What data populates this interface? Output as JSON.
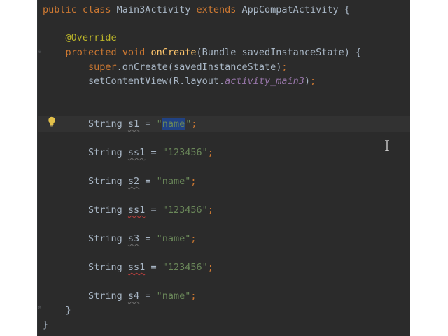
{
  "lines": [
    {
      "parts": [
        {
          "t": "public class ",
          "c": "kw"
        },
        {
          "t": "Main3Activity ",
          "c": ""
        },
        {
          "t": "extends ",
          "c": "kw"
        },
        {
          "t": "AppCompatActivity {",
          "c": ""
        }
      ]
    },
    {
      "parts": [
        {
          "t": "    @Override",
          "c": "ann"
        }
      ]
    },
    {
      "parts": [
        {
          "t": "    protected void ",
          "c": "kw"
        },
        {
          "t": "onCreate",
          "c": "fn"
        },
        {
          "t": "(Bundle savedInstanceState) {",
          "c": ""
        }
      ]
    },
    {
      "parts": [
        {
          "t": "        super",
          "c": "kw"
        },
        {
          "t": ".onCreate(savedInstanceState)",
          "c": ""
        },
        {
          "t": ";",
          "c": "kw"
        }
      ]
    },
    {
      "parts": [
        {
          "t": "        setContentView(R.layout.",
          "c": ""
        },
        {
          "t": "activity_main3",
          "c": "ital"
        },
        {
          "t": ")",
          "c": ""
        },
        {
          "t": ";",
          "c": "kw"
        }
      ]
    },
    {
      "parts": [
        {
          "t": "        String ",
          "c": ""
        },
        {
          "t": "s1",
          "c": "var"
        },
        {
          "t": " = ",
          "c": ""
        },
        {
          "t": "\"",
          "c": "str"
        },
        {
          "t": "name",
          "c": "str sel"
        },
        {
          "t": "\"",
          "c": "str caretafter"
        },
        {
          "t": ";",
          "c": "kw"
        }
      ]
    },
    {
      "parts": [
        {
          "t": "        String ",
          "c": ""
        },
        {
          "t": "ss1",
          "c": "var"
        },
        {
          "t": " = ",
          "c": ""
        },
        {
          "t": "\"123456\"",
          "c": "str"
        },
        {
          "t": ";",
          "c": "kw"
        }
      ]
    },
    {
      "parts": [
        {
          "t": "        String ",
          "c": ""
        },
        {
          "t": "s2",
          "c": "var"
        },
        {
          "t": " = ",
          "c": ""
        },
        {
          "t": "\"name\"",
          "c": "str"
        },
        {
          "t": ";",
          "c": "kw"
        }
      ]
    },
    {
      "parts": [
        {
          "t": "        String ",
          "c": ""
        },
        {
          "t": "ss1",
          "c": "varred"
        },
        {
          "t": " = ",
          "c": ""
        },
        {
          "t": "\"123456\"",
          "c": "str"
        },
        {
          "t": ";",
          "c": "kw"
        }
      ]
    },
    {
      "parts": [
        {
          "t": "        String ",
          "c": ""
        },
        {
          "t": "s3",
          "c": "var"
        },
        {
          "t": " = ",
          "c": ""
        },
        {
          "t": "\"name\"",
          "c": "str"
        },
        {
          "t": ";",
          "c": "kw"
        }
      ]
    },
    {
      "parts": [
        {
          "t": "        String ",
          "c": ""
        },
        {
          "t": "ss1",
          "c": "varred"
        },
        {
          "t": " = ",
          "c": ""
        },
        {
          "t": "\"123456\"",
          "c": "str"
        },
        {
          "t": ";",
          "c": "kw"
        }
      ]
    },
    {
      "parts": [
        {
          "t": "        String ",
          "c": ""
        },
        {
          "t": "s4",
          "c": "var"
        },
        {
          "t": " = ",
          "c": ""
        },
        {
          "t": "\"name\"",
          "c": "str"
        },
        {
          "t": ";",
          "c": "kw"
        }
      ]
    },
    {
      "parts": [
        {
          "t": "    }",
          "c": ""
        }
      ]
    },
    {
      "parts": [
        {
          "t": "}",
          "c": ""
        }
      ]
    }
  ],
  "colors": {
    "background": "#2b2b2b",
    "keyword": "#cc7832",
    "string": "#6a8759",
    "annotation": "#bbb529",
    "method": "#ffc66d",
    "field": "#9876aa",
    "text": "#a9b7c6",
    "selection": "#214283"
  },
  "icons": [
    "lightbulb-icon",
    "fold-icon",
    "text-cursor-icon"
  ]
}
